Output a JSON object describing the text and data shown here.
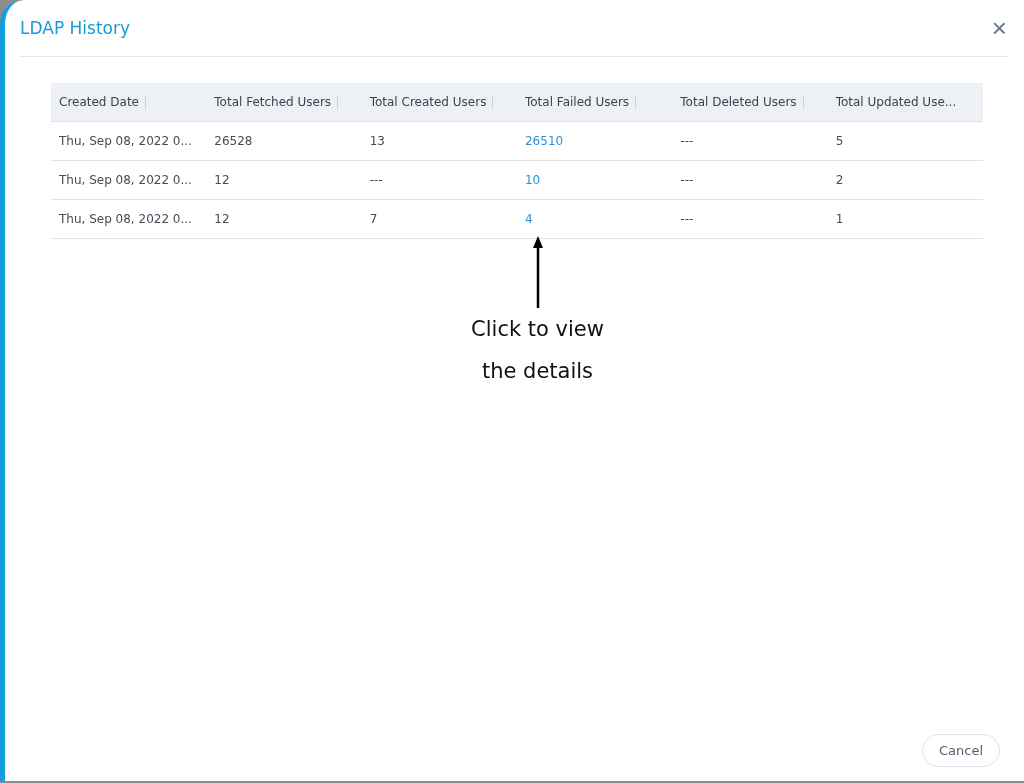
{
  "dialog": {
    "title": "LDAP History",
    "close_icon": "×"
  },
  "table": {
    "columns": [
      {
        "label": "Created Date",
        "kind": "text"
      },
      {
        "label": "Total Fetched Users",
        "kind": "text"
      },
      {
        "label": "Total Created Users",
        "kind": "text"
      },
      {
        "label": "Total Failed Users",
        "kind": "link"
      },
      {
        "label": "Total Deleted Users",
        "kind": "text"
      },
      {
        "label": "Total Updated Use...",
        "kind": "text"
      }
    ],
    "rows": [
      [
        "Thu, Sep 08, 2022 0...",
        "26528",
        "13",
        "26510",
        "---",
        "5"
      ],
      [
        "Thu, Sep 08, 2022 0...",
        "12",
        "---",
        "10",
        "---",
        "2"
      ],
      [
        "Thu, Sep 08, 2022 0...",
        "12",
        "7",
        "4",
        "---",
        "1"
      ]
    ]
  },
  "annotation": {
    "lines": [
      "Click to view",
      "the details"
    ]
  },
  "buttons": [
    {
      "label": "Cancel"
    }
  ]
}
